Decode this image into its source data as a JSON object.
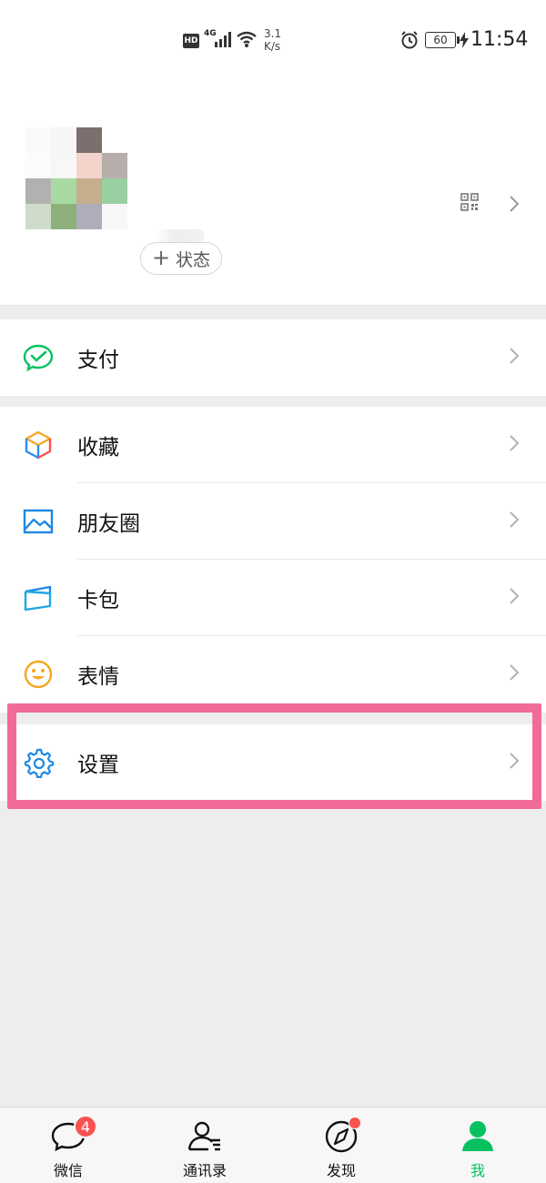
{
  "status_bar": {
    "hd": "HD",
    "network": "4G",
    "speed_value": "3.1",
    "speed_unit": "K/s",
    "battery": "60",
    "time": "11:54"
  },
  "profile": {
    "status_button_label": "状态",
    "status_button_icon": "plus-icon",
    "avatar_colors": [
      "#fafafa",
      "#f6f6f6",
      "#7c6f6e",
      "#ffffff",
      "#fcfcfc",
      "#f7f7f7",
      "#f4d4ca",
      "#b7aeab",
      "#b1b1b1",
      "#a8d9a2",
      "#c5ae8b",
      "#98d0a3",
      "#cfdccb",
      "#8eb17c",
      "#aeadb9",
      "#f8f8f8"
    ]
  },
  "menu": {
    "pay": {
      "label": "支付",
      "icon": "wechat-pay-icon"
    },
    "favorites": {
      "label": "收藏",
      "icon": "cube-icon"
    },
    "moments": {
      "label": "朋友圈",
      "icon": "image-icon"
    },
    "cards": {
      "label": "卡包",
      "icon": "wallet-icon"
    },
    "stickers": {
      "label": "表情",
      "icon": "smile-icon"
    },
    "settings": {
      "label": "设置",
      "icon": "gear-icon"
    }
  },
  "tabbar": {
    "chats": {
      "label": "微信",
      "badge": "4"
    },
    "contacts": {
      "label": "通讯录"
    },
    "discover": {
      "label": "发现"
    },
    "me": {
      "label": "我"
    }
  },
  "colors": {
    "accent_green": "#07c160",
    "badge_red": "#fa5151",
    "highlight_pink": "#f06c96",
    "background": "#ededed"
  }
}
